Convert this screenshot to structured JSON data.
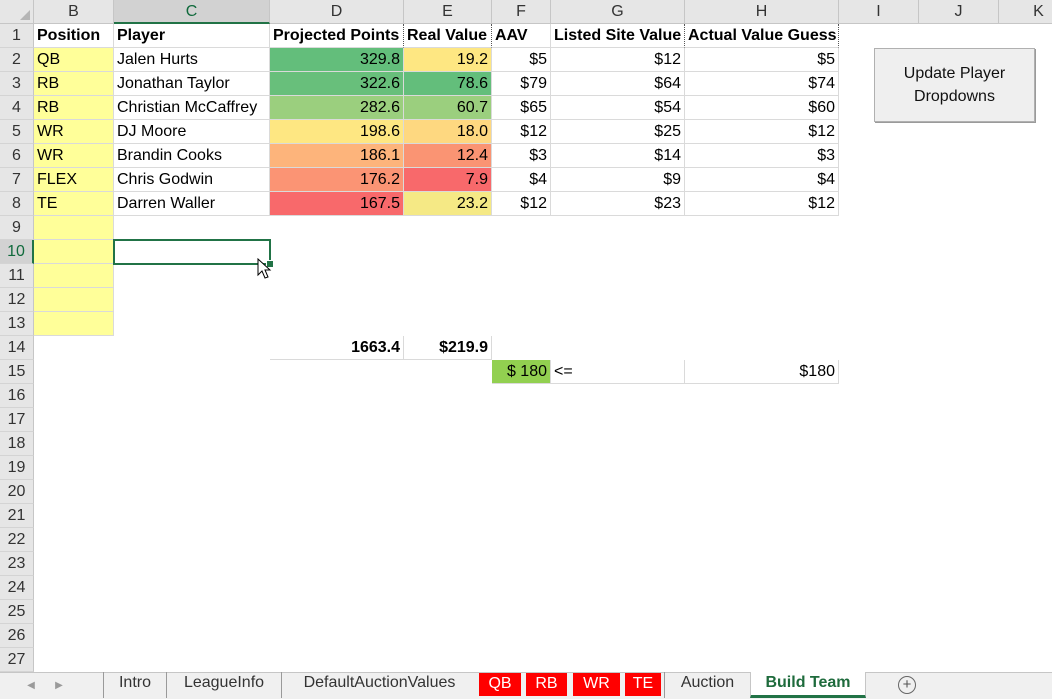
{
  "columns": [
    "B",
    "C",
    "D",
    "E",
    "F",
    "G",
    "H",
    "I",
    "J",
    "K"
  ],
  "rows": [
    "1",
    "2",
    "3",
    "4",
    "5",
    "6",
    "7",
    "8",
    "9",
    "10",
    "11",
    "12",
    "13",
    "14",
    "15",
    "16",
    "17",
    "18",
    "19",
    "20",
    "21",
    "22",
    "23",
    "24",
    "25",
    "26",
    "27"
  ],
  "selected": {
    "column": "C",
    "row": "10"
  },
  "headers": {
    "position": "Position",
    "player": "Player",
    "projected_points": "Projected Points",
    "real_value": "Real Value",
    "aav": "AAV",
    "listed_site_value": "Listed Site Value",
    "actual_value_guess": "Actual Value Guess"
  },
  "players": [
    {
      "position": "QB",
      "player": "Jalen Hurts",
      "projected": "329.8",
      "real": "19.2",
      "aav": "$5",
      "listed": "$12",
      "guess": "$5",
      "proj_color": "#63be7b",
      "real_color": "#fee782"
    },
    {
      "position": "RB",
      "player": "Jonathan Taylor",
      "projected": "322.6",
      "real": "78.6",
      "aav": "$79",
      "listed": "$64",
      "guess": "$74",
      "proj_color": "#68bf7b",
      "real_color": "#63be7b"
    },
    {
      "position": "RB",
      "player": "Christian McCaffrey",
      "projected": "282.6",
      "real": "60.7",
      "aav": "$65",
      "listed": "$54",
      "guess": "$60",
      "proj_color": "#9bcf7e",
      "real_color": "#9bcf7e"
    },
    {
      "position": "WR",
      "player": "DJ Moore",
      "projected": "198.6",
      "real": "18.0",
      "aav": "$12",
      "listed": "$25",
      "guess": "$12",
      "proj_color": "#fee782",
      "real_color": "#fed880"
    },
    {
      "position": "WR",
      "player": "Brandin Cooks",
      "projected": "186.1",
      "real": "12.4",
      "aav": "$3",
      "listed": "$14",
      "guess": "$3",
      "proj_color": "#fdb47b",
      "real_color": "#fa9473"
    },
    {
      "position": "FLEX",
      "player": "Chris Godwin",
      "projected": "176.2",
      "real": "7.9",
      "aav": "$4",
      "listed": "$9",
      "guess": "$4",
      "proj_color": "#fb9474",
      "real_color": "#f8696b"
    },
    {
      "position": "TE",
      "player": "Darren Waller",
      "projected": "167.5",
      "real": "23.2",
      "aav": "$12",
      "listed": "$23",
      "guess": "$12",
      "proj_color": "#f8696b",
      "real_color": "#f5e985"
    }
  ],
  "totals": {
    "projected": "1663.4",
    "real": "$219.9"
  },
  "budget": {
    "value": "$ 180",
    "operator": "<=",
    "guess_total": "$180",
    "color": "#92d050"
  },
  "button": {
    "line1": "Update Player",
    "line2": "Dropdowns"
  },
  "tabs": [
    "Intro",
    "LeagueInfo",
    "DefaultAuctionValues",
    "QB",
    "RB",
    "WR",
    "TE",
    "Auction",
    "Build Team"
  ],
  "active_tab": "Build Team",
  "colors": {
    "highlight_yellow": "#ffff99",
    "excel_green": "#217346",
    "red_tab": "#ff0000"
  }
}
